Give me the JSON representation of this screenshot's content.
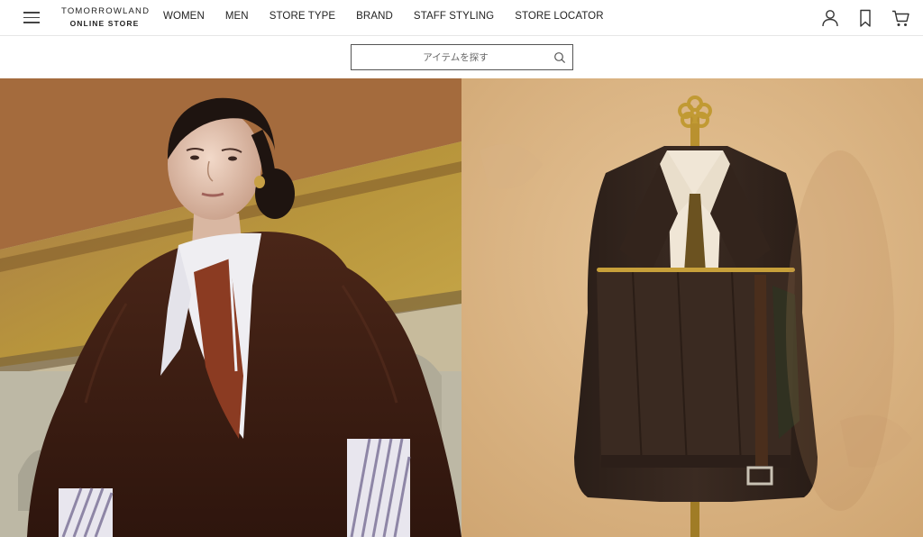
{
  "header": {
    "logo": {
      "line1": "TOMORROWLAND",
      "line2": "ONLINE STORE"
    },
    "menu_icon": "hamburger-menu-icon",
    "nav": [
      {
        "label": "WOMEN"
      },
      {
        "label": "MEN"
      },
      {
        "label": "STORE TYPE"
      },
      {
        "label": "BRAND"
      },
      {
        "label": "STAFF STYLING"
      },
      {
        "label": "STORE LOCATOR"
      }
    ],
    "icons": [
      "user-icon",
      "bookmark-icon",
      "cart-icon"
    ]
  },
  "search": {
    "placeholder": "アイテムを探す",
    "icon": "search-icon"
  },
  "hero": {
    "panels": [
      {
        "subject": "woman-in-brown-fur-cape-with-scarf"
      },
      {
        "subject": "brown-suit-on-brass-valet-stand"
      }
    ]
  },
  "colors": {
    "text": "#222222",
    "border": "#555555",
    "divider": "#e6e6e6",
    "fur_brown": "#3b1e14",
    "mustard_wall": "#b99a3a",
    "beige_wall": "#d9b487",
    "brass": "#b9912f"
  }
}
